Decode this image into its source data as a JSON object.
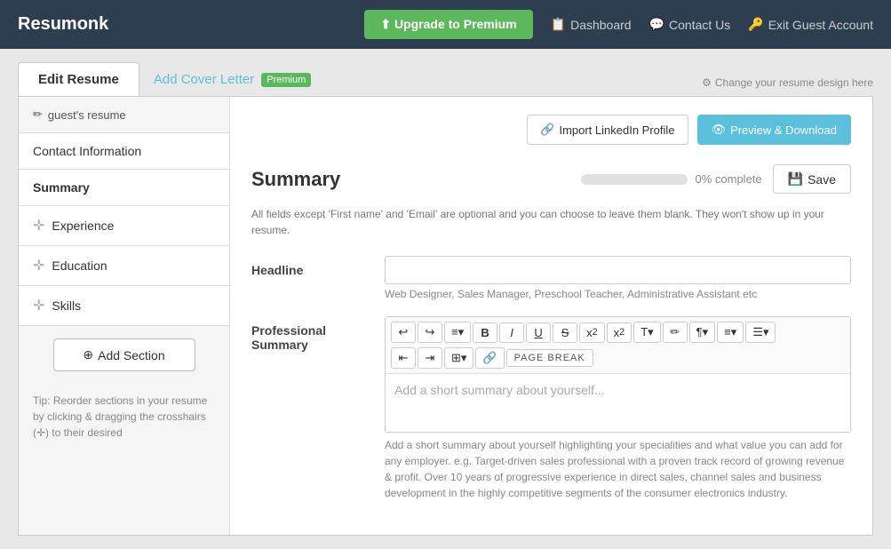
{
  "brand": "Resumonk",
  "topnav": {
    "upgrade_label": "⬆ Upgrade to Premium",
    "dashboard_icon": "📋",
    "dashboard_label": "Dashboard",
    "contact_icon": "💬",
    "contact_label": "Contact Us",
    "exit_icon": "🔑",
    "exit_label": "Exit Guest Account"
  },
  "tabs": {
    "edit_label": "Edit Resume",
    "cover_label": "Add Cover Letter",
    "cover_badge": "Premium",
    "change_design": "Change your resume design here"
  },
  "sidebar": {
    "header": "guest's resume",
    "pencil_icon": "✏",
    "items": [
      {
        "label": "Contact Information",
        "draggable": false
      },
      {
        "label": "Summary",
        "active": true,
        "draggable": false
      },
      {
        "label": "Experience",
        "draggable": true
      },
      {
        "label": "Education",
        "draggable": true
      },
      {
        "label": "Skills",
        "draggable": true
      }
    ],
    "add_section_label": "Add Section",
    "add_section_icon": "⊕",
    "tip": "Tip: Reorder sections in your resume by clicking & dragging the crosshairs (✛) to their desired"
  },
  "header_bar": {
    "import_icon": "🔗",
    "import_label": "Import LinkedIn Profile",
    "preview_icon": "👁",
    "preview_label": "Preview & Download"
  },
  "content": {
    "title": "Summary",
    "progress": "0% complete",
    "save_icon": "💾",
    "save_label": "Save",
    "hint": "All fields except 'First name' and 'Email' are optional and you can choose to leave them blank. They won't show up in your resume.",
    "headline_label": "Headline",
    "headline_placeholder": "",
    "headline_hint": "Web Designer, Sales Manager, Preschool Teacher, Administrative Assistant etc",
    "pro_summary_label": "Professional Summary",
    "rte_placeholder": "Add a short summary about yourself...",
    "rte_hint": "Add a short summary about yourself highlighting your specialities and what value you can add for any employer. e.g. Target-driven sales professional with a proven track record of growing revenue & profit. Over 10 years of progressive experience in direct sales, channel sales and business development in the highly competitive segments of the consumer electronics industry.",
    "toolbar_row1": [
      {
        "label": "↩",
        "title": "Undo"
      },
      {
        "label": "↪",
        "title": "Redo"
      },
      {
        "label": "≡▾",
        "title": "Paragraph"
      },
      {
        "label": "B",
        "title": "Bold",
        "bold": true
      },
      {
        "label": "I",
        "title": "Italic",
        "italic": true
      },
      {
        "label": "U̲",
        "title": "Underline"
      },
      {
        "label": "S̶",
        "title": "Strikethrough"
      },
      {
        "label": "x₂",
        "title": "Subscript"
      },
      {
        "label": "x²",
        "title": "Superscript"
      },
      {
        "label": "T▾",
        "title": "Font Size"
      },
      {
        "label": "✏",
        "title": "Highlight"
      },
      {
        "label": "¶▾",
        "title": "Paragraph Format"
      },
      {
        "label": "≡▾",
        "title": "List"
      },
      {
        "label": "☰▾",
        "title": "Align"
      }
    ],
    "toolbar_row2": [
      {
        "label": "⇤",
        "title": "Outdent"
      },
      {
        "label": "⇥",
        "title": "Indent"
      },
      {
        "label": "⊞▾",
        "title": "Table"
      },
      {
        "label": "🔗",
        "title": "Link"
      },
      {
        "label": "PAGE BREAK",
        "title": "Page Break",
        "page_break": true
      }
    ]
  }
}
